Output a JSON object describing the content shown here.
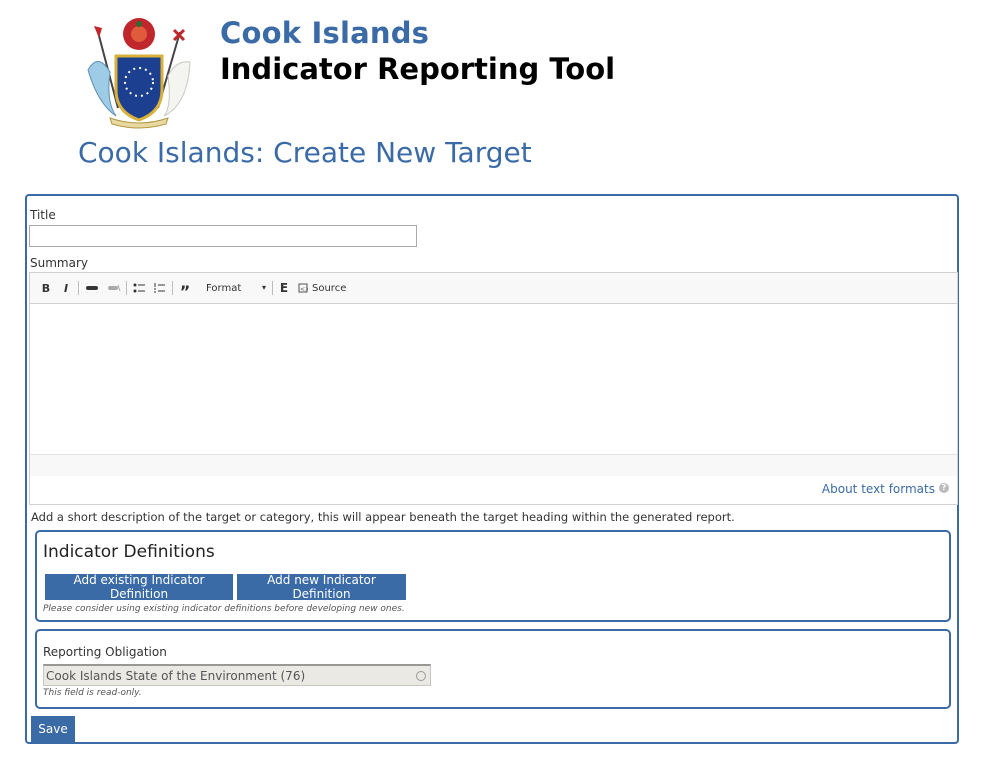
{
  "header": {
    "site_name": "Cook Islands",
    "site_slogan": "Indicator Reporting Tool",
    "crest_icon": "coat-of-arms-icon"
  },
  "page_title": "Cook Islands: Create New Target",
  "form": {
    "title_label": "Title",
    "title_value": "",
    "summary_label": "Summary",
    "toolbar": {
      "bold": "B",
      "italic": "I",
      "format_label": "Format",
      "source_label": "Source"
    },
    "about_text_formats": "About text formats",
    "summary_description": "Add a short description of the target or category, this will appear beneath the target heading within the generated report.",
    "indicator_definitions": {
      "heading": "Indicator Definitions",
      "add_existing_label": "Add existing Indicator Definition",
      "add_new_label": "Add new Indicator Definition",
      "hint": "Please consider using existing indicator definitions before developing new ones."
    },
    "reporting_obligation": {
      "label": "Reporting Obligation",
      "value": "Cook Islands State of the Environment (76)",
      "hint": "This field is read-only."
    },
    "save_label": "Save"
  },
  "colors": {
    "accent": "#3b6ba7",
    "readonly_bg": "#ebe9e4"
  }
}
